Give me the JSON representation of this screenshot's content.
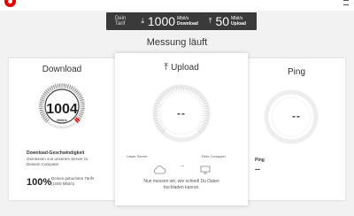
{
  "header": {
    "logo": "vodafone-logo",
    "menu_icon": "menu-icon"
  },
  "tariff": {
    "label": "Dein Tarif",
    "download_value": "1000",
    "download_unit": "Mbit/s",
    "download_label": "Download",
    "upload_value": "50",
    "upload_unit": "Mbit/s",
    "upload_label": "Upload"
  },
  "status_title": "Messung läuft",
  "download": {
    "title": "Download",
    "value": "1004",
    "unit": "Mbit/s",
    "heading": "Download-Geschwindigkeit",
    "description_line1": "Gemessen von unserem Server zu",
    "description_line2": "Deinem Computer",
    "percent": "100%",
    "percent_note_line1": "Deines gebuchten Tarifs",
    "percent_note_line2": "(1000 Mbit/s)",
    "gauge_fill": 1.0
  },
  "upload": {
    "title": "Upload",
    "value": "--",
    "server_label": "Unser Server",
    "computer_label": "Dein Computer",
    "connector": "–",
    "info_line1": "Nun messen wir, wie schnell Du Daten",
    "info_line2": "hochladen kannst."
  },
  "ping": {
    "title": "Ping",
    "value": "--",
    "label": "Ping",
    "result": "--"
  },
  "colors": {
    "accent": "#e60000",
    "dark_bar": "#3a3a3a",
    "background": "#f2f2f2"
  }
}
